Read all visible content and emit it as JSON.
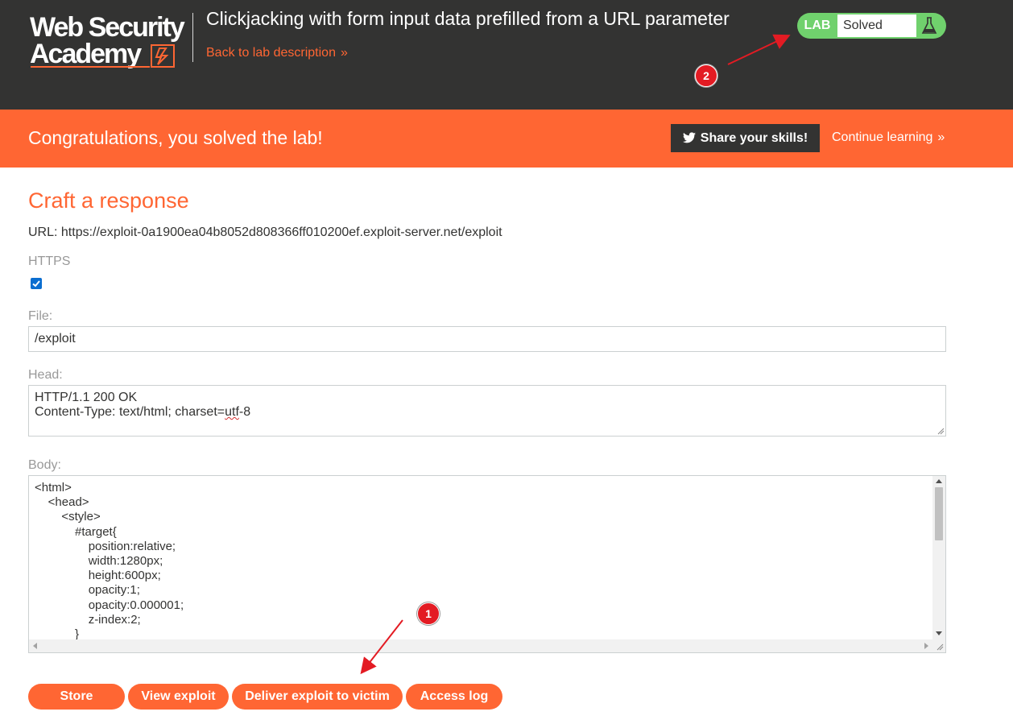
{
  "header": {
    "logo_line1": "Web Security",
    "logo_line2": "Academy",
    "lab_title": "Clickjacking with form input data prefilled from a URL parameter",
    "back_link": "Back to lab description",
    "lab_badge": "LAB",
    "lab_status": "Solved",
    "status_color": "#70d16d"
  },
  "banner": {
    "message": "Congratulations, you solved the lab!",
    "share_label": "Share your skills!",
    "continue_label": "Continue learning",
    "color": "#ff6633"
  },
  "form": {
    "title": "Craft a response",
    "url_line": "URL: https://exploit-0a1900ea04b8052d808366ff010200ef.exploit-server.net/exploit",
    "https_label": "HTTPS",
    "https_checked": true,
    "file_label": "File:",
    "file_value": "/exploit",
    "head_label": "Head:",
    "head_line1": "HTTP/1.1 200 OK",
    "head_line2_prefix": "Content-Type: text/html; charset=",
    "head_line2_flagged": "utf",
    "head_line2_suffix": "-8",
    "body_label": "Body:",
    "body_value": "<html>\n\t<head>\n\t\t<style>\n\t\t\t#target{\n\t\t\t\tposition:relative;\n\t\t\t\twidth:1280px;\n\t\t\t\theight:600px;\n\t\t\t\topacity:1;\n\t\t\t\topacity:0.000001;\n\t\t\t\tz-index:2;\n\t\t\t}"
  },
  "actions": {
    "store": "Store",
    "view_exploit": "View exploit",
    "deliver": "Deliver exploit to victim",
    "access_log": "Access log"
  },
  "annotations": {
    "marker_1": "1",
    "marker_2": "2",
    "color": "#e31b23"
  }
}
